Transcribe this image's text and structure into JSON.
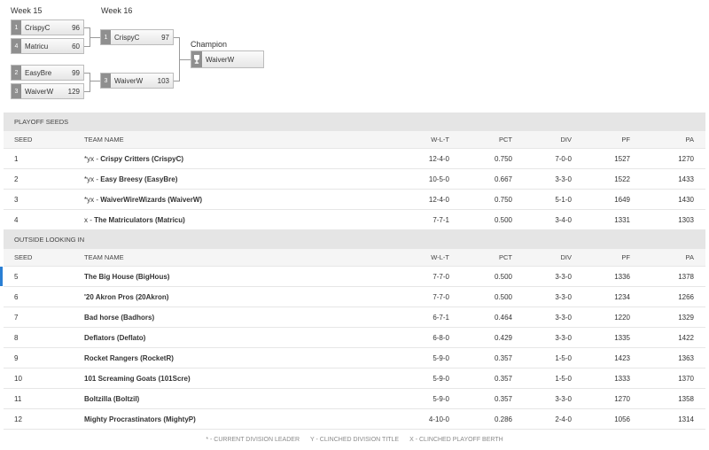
{
  "bracket": {
    "weeks": [
      "Week 15",
      "Week 16"
    ],
    "round1": [
      {
        "seed": "1",
        "team": "CrispyC",
        "score": "96"
      },
      {
        "seed": "4",
        "team": "Matricu",
        "score": "60"
      },
      {
        "seed": "2",
        "team": "EasyBre",
        "score": "99"
      },
      {
        "seed": "3",
        "team": "WaiverW",
        "score": "129"
      }
    ],
    "round2": [
      {
        "seed": "1",
        "team": "CrispyC",
        "score": "97"
      },
      {
        "seed": "3",
        "team": "WaiverW",
        "score": "103"
      }
    ],
    "champion_label": "Champion",
    "champion": {
      "icon": "trophy-icon",
      "team": "WaiverW"
    }
  },
  "columns": {
    "seed": "SEED",
    "team": "TEAM NAME",
    "wlt": "W-L-T",
    "pct": "PCT",
    "div": "DIV",
    "pf": "PF",
    "pa": "PA"
  },
  "playoff": {
    "title": "PLAYOFF SEEDS",
    "rows": [
      {
        "seed": "1",
        "tag": "*yx - ",
        "team": "Crispy Critters (CrispyC)",
        "wlt": "12-4-0",
        "pct": "0.750",
        "div": "7-0-0",
        "pf": "1527",
        "pa": "1270"
      },
      {
        "seed": "2",
        "tag": "*yx - ",
        "team": "Easy Breesy (EasyBre)",
        "wlt": "10-5-0",
        "pct": "0.667",
        "div": "3-3-0",
        "pf": "1522",
        "pa": "1433"
      },
      {
        "seed": "3",
        "tag": "*yx - ",
        "team": "WaiverWireWizards (WaiverW)",
        "wlt": "12-4-0",
        "pct": "0.750",
        "div": "5-1-0",
        "pf": "1649",
        "pa": "1430"
      },
      {
        "seed": "4",
        "tag": "x - ",
        "team": "The Matriculators (Matricu)",
        "wlt": "7-7-1",
        "pct": "0.500",
        "div": "3-4-0",
        "pf": "1331",
        "pa": "1303"
      }
    ]
  },
  "outside": {
    "title": "OUTSIDE LOOKING IN",
    "rows": [
      {
        "seed": "5",
        "team": "The Big House (BigHous)",
        "wlt": "7-7-0",
        "pct": "0.500",
        "div": "3-3-0",
        "pf": "1336",
        "pa": "1378"
      },
      {
        "seed": "6",
        "team": "'20 Akron Pros (20Akron)",
        "wlt": "7-7-0",
        "pct": "0.500",
        "div": "3-3-0",
        "pf": "1234",
        "pa": "1266"
      },
      {
        "seed": "7",
        "team": "Bad horse (Badhors)",
        "wlt": "6-7-1",
        "pct": "0.464",
        "div": "3-3-0",
        "pf": "1220",
        "pa": "1329"
      },
      {
        "seed": "8",
        "team": "Deflators (Deflato)",
        "wlt": "6-8-0",
        "pct": "0.429",
        "div": "3-3-0",
        "pf": "1335",
        "pa": "1422"
      },
      {
        "seed": "9",
        "team": "Rocket Rangers (RocketR)",
        "wlt": "5-9-0",
        "pct": "0.357",
        "div": "1-5-0",
        "pf": "1423",
        "pa": "1363"
      },
      {
        "seed": "10",
        "team": "101 Screaming Goats (101Scre)",
        "wlt": "5-9-0",
        "pct": "0.357",
        "div": "1-5-0",
        "pf": "1333",
        "pa": "1370"
      },
      {
        "seed": "11",
        "team": "Boltzilla (Boltzil)",
        "wlt": "5-9-0",
        "pct": "0.357",
        "div": "3-3-0",
        "pf": "1270",
        "pa": "1358"
      },
      {
        "seed": "12",
        "team": "Mighty Procrastinators (MightyP)",
        "wlt": "4-10-0",
        "pct": "0.286",
        "div": "2-4-0",
        "pf": "1056",
        "pa": "1314"
      }
    ]
  },
  "legend": [
    "* - CURRENT DIVISION LEADER",
    "Y - CLINCHED DIVISION TITLE",
    "X - CLINCHED PLAYOFF BERTH"
  ],
  "colors": {
    "accent": "#2a7fd4",
    "seed_box": "#8f8f8f",
    "section_bg": "#e5e5e5"
  }
}
